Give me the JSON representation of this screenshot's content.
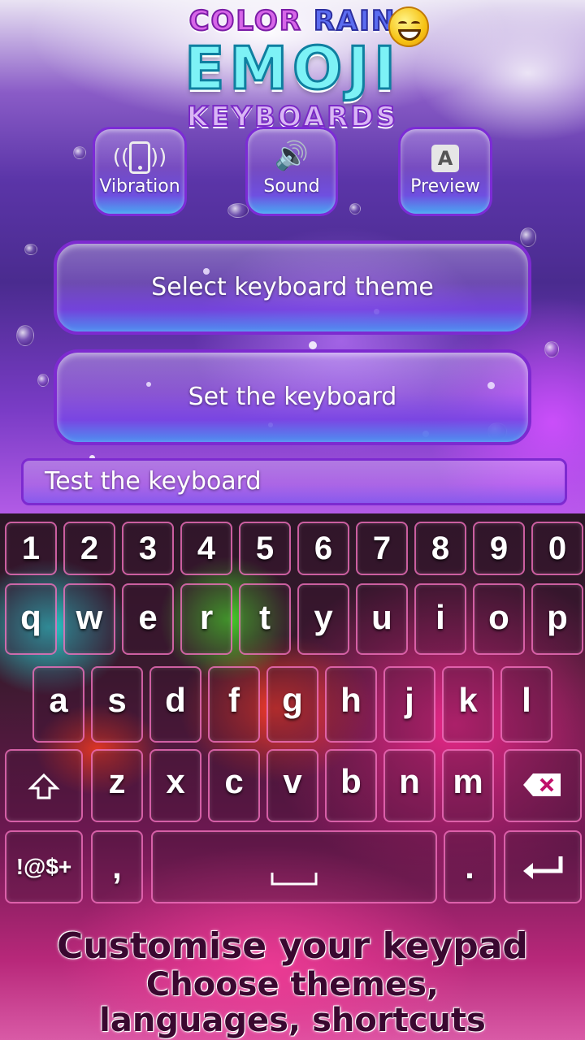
{
  "logo": {
    "line1_a": "COLOR",
    "line1_b": "RAIN",
    "line2": "EMOJI",
    "line3": "KEYBOARDS"
  },
  "options": [
    {
      "label": "Vibration",
      "icon": "vibration-icon"
    },
    {
      "label": "Sound",
      "icon": "speaker-icon"
    },
    {
      "label": "Preview",
      "icon": "preview-icon",
      "glyph": "A"
    }
  ],
  "buttons": {
    "select_theme": "Select keyboard theme",
    "set_keyboard": "Set the keyboard"
  },
  "test_field": {
    "placeholder": "Test the keyboard"
  },
  "keyboard": {
    "row_numbers": [
      "1",
      "2",
      "3",
      "4",
      "5",
      "6",
      "7",
      "8",
      "9",
      "0"
    ],
    "row_top": [
      "q",
      "w",
      "e",
      "r",
      "t",
      "y",
      "u",
      "i",
      "o",
      "p"
    ],
    "row_middle": [
      "a",
      "s",
      "d",
      "f",
      "g",
      "h",
      "j",
      "k",
      "l"
    ],
    "row_bottom": [
      "z",
      "x",
      "c",
      "v",
      "b",
      "n",
      "m"
    ],
    "symbols_label": "!@$+",
    "comma": ",",
    "period": "."
  },
  "footer": {
    "line1": "Customise your keypad",
    "line2": "Choose themes,",
    "line3": "languages, shortcuts"
  },
  "colors": {
    "accent_purple": "#7d2ad0",
    "key_border": "#ff78c8"
  }
}
